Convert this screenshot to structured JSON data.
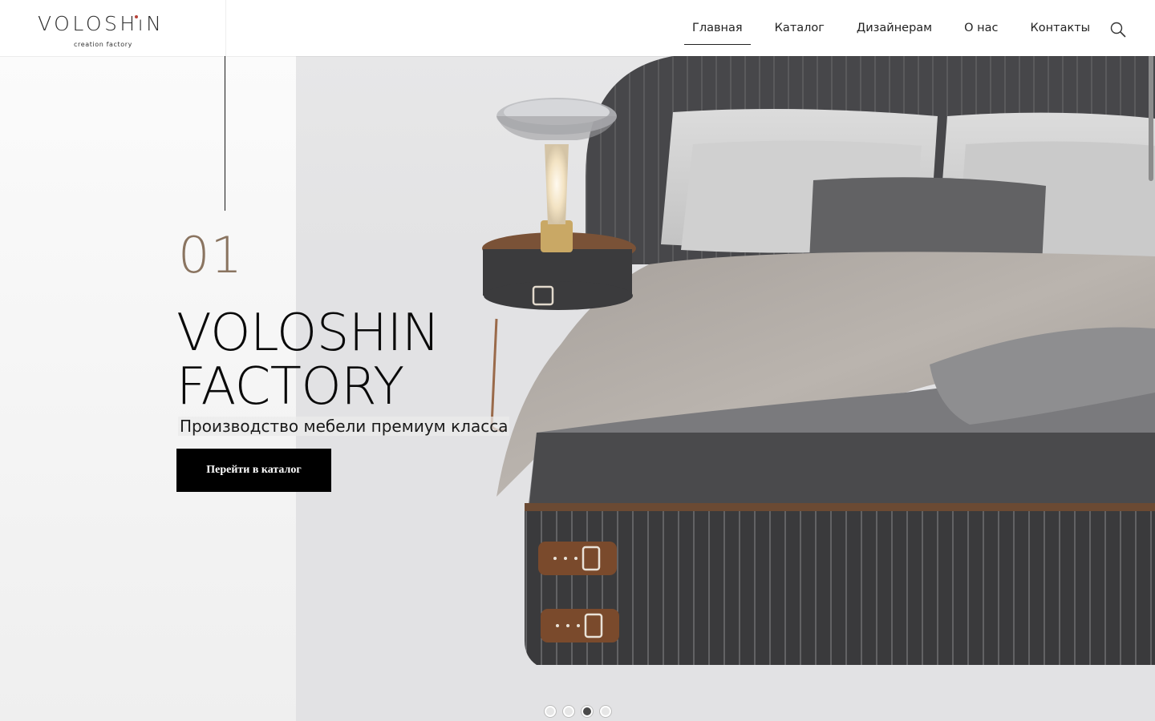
{
  "logo": {
    "text": "VOLOSHıN",
    "subtitle": "creation factory",
    "accent": "#b8433a"
  },
  "nav": {
    "items": [
      {
        "label": "Главная",
        "active": true
      },
      {
        "label": "Каталог",
        "active": false
      },
      {
        "label": "Дизайнерам",
        "active": false
      },
      {
        "label": "О нас",
        "active": false
      },
      {
        "label": "Контакты",
        "active": false
      }
    ],
    "search_icon": "search-icon"
  },
  "hero": {
    "slide_number": "01",
    "title": "VOLOSHIN\nFACTORY",
    "subtitle": "Производство мебели премиум класса",
    "cta_label": "Перейти в каталог",
    "image": "bed-with-nightstand-lamp"
  },
  "slider": {
    "count": 4,
    "active_index": 2
  },
  "colors": {
    "accent_number": "#8a7460",
    "button_bg": "#000000",
    "leather": "#7a4a2c",
    "fabric": "#3b3b3d"
  }
}
